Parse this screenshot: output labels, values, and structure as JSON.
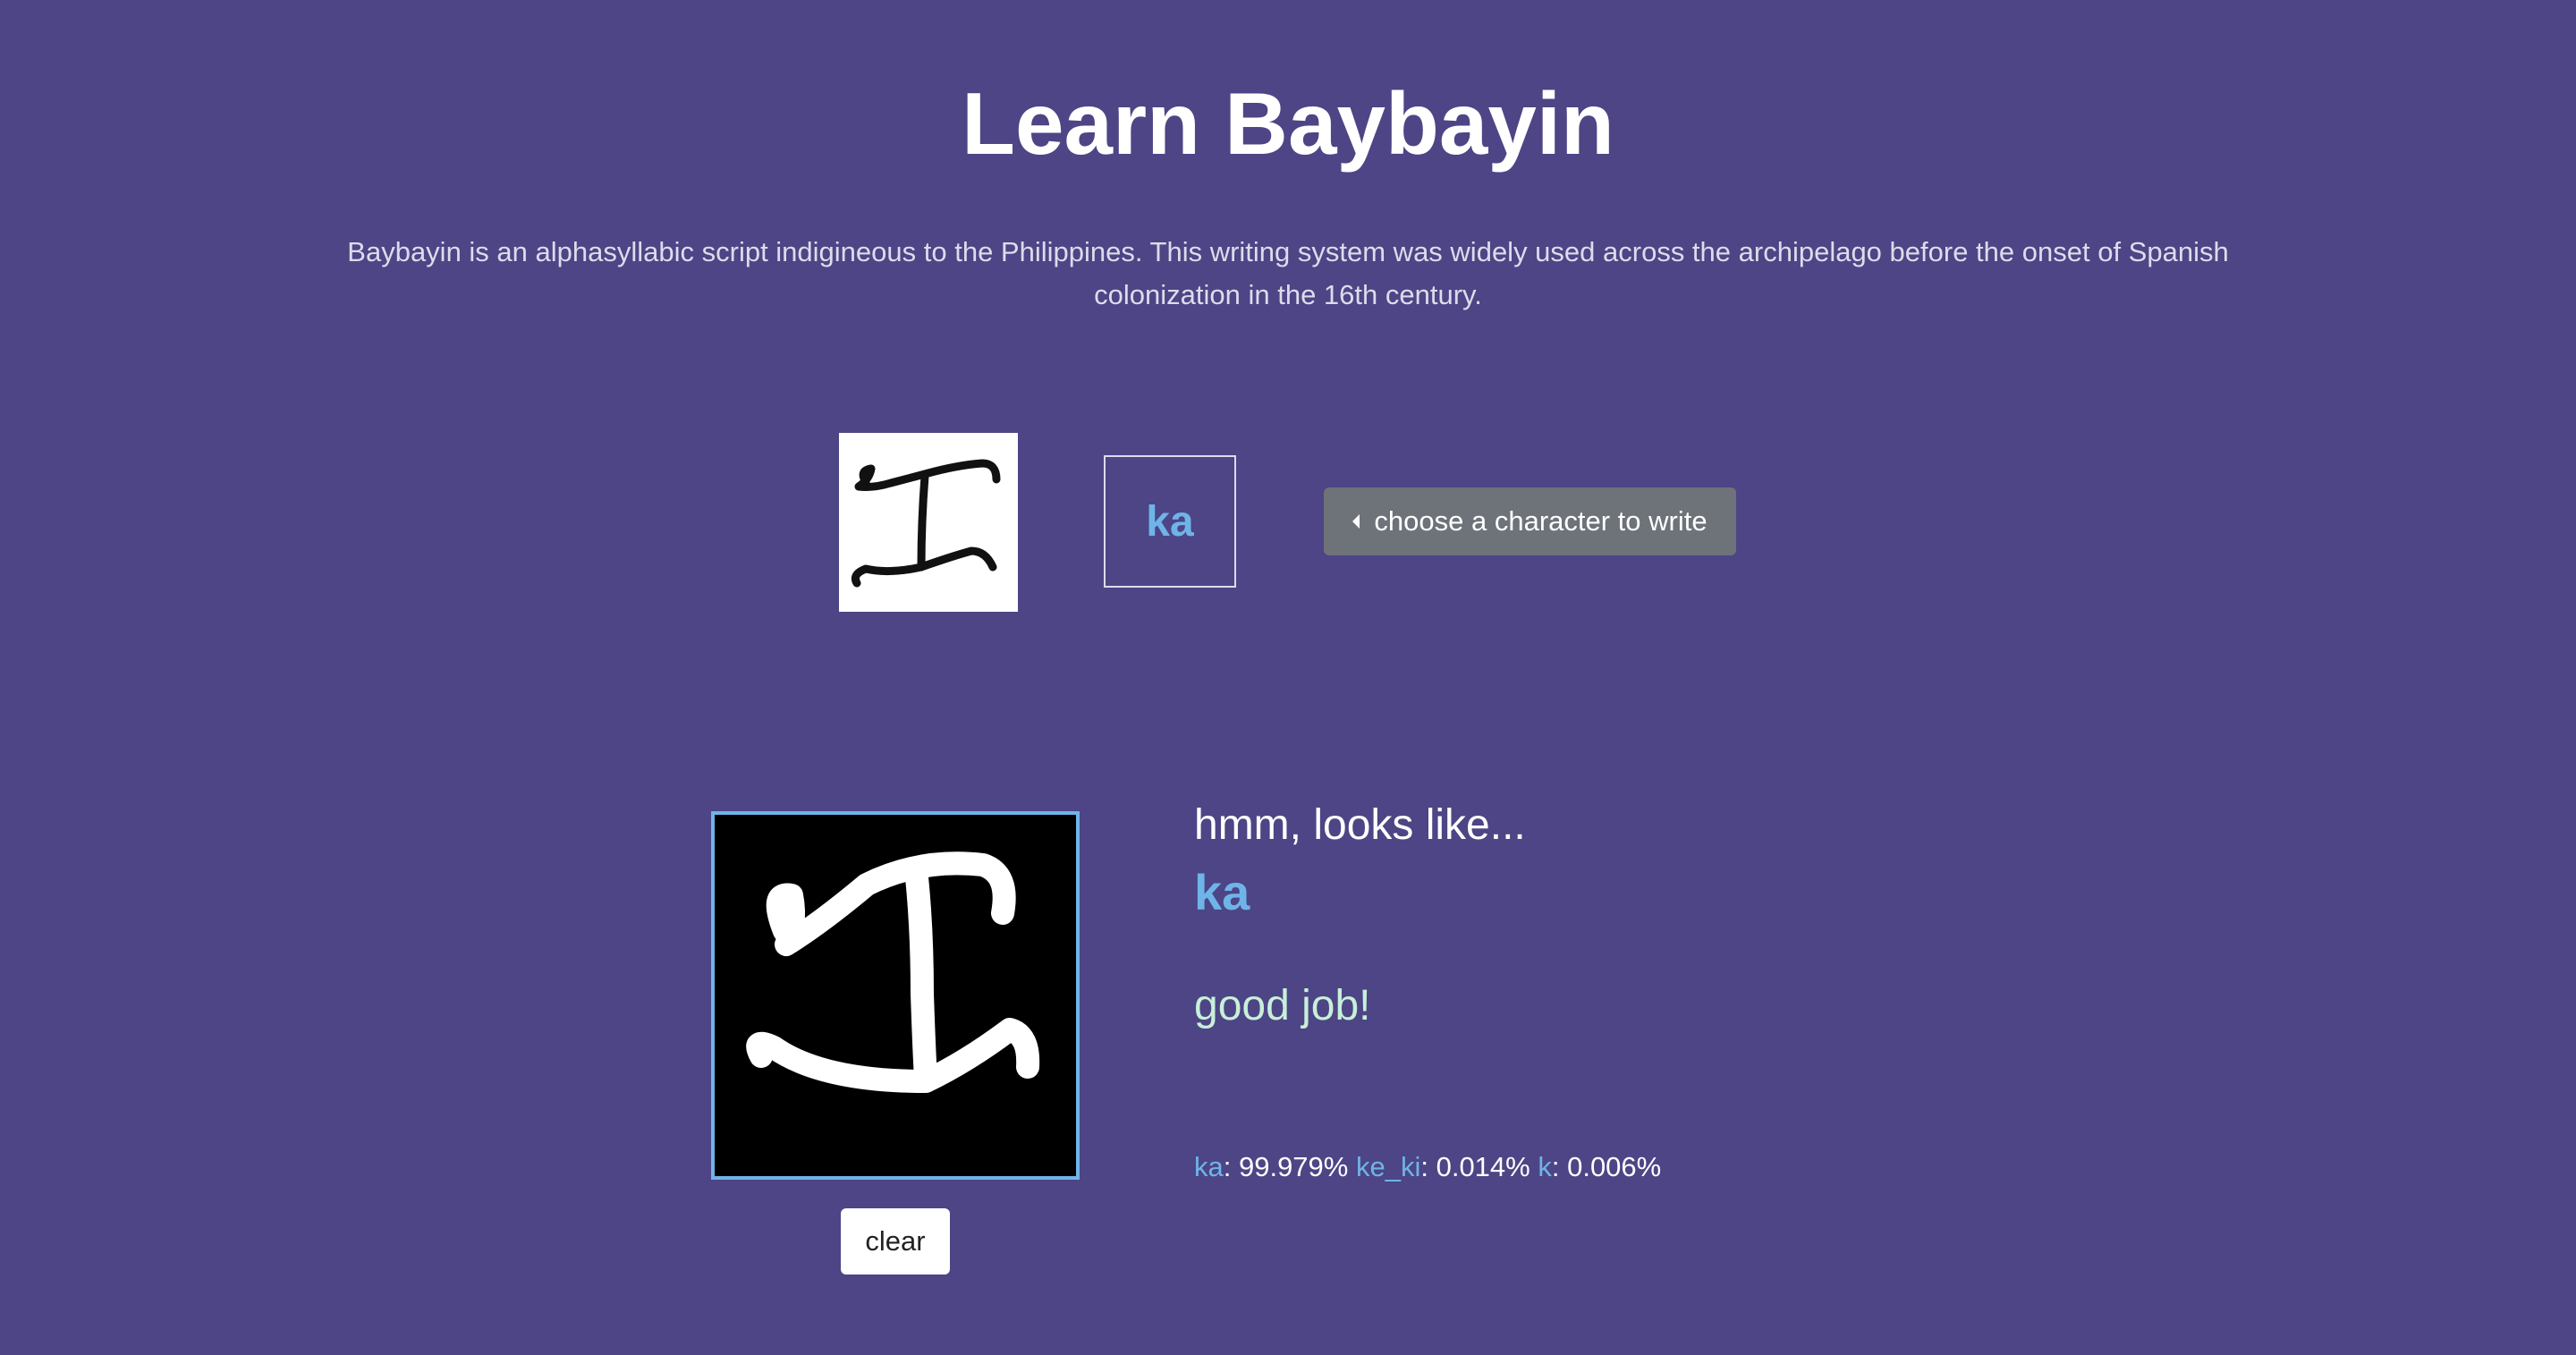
{
  "page": {
    "title": "Learn Baybayin",
    "description": "Baybayin is an alphasyllabic script indigineous to the Philippines. This writing system was widely used across the archipelago before the onset of Spanish colonization in the 16th century."
  },
  "selector": {
    "reference_image_icon": "baybayin-ka-glyph",
    "current_character": "ka",
    "choose_button_label": "choose a character to write",
    "choose_button_icon": "caret-left-icon"
  },
  "drawing": {
    "canvas_icon": "baybayin-ka-drawing",
    "clear_label": "clear"
  },
  "result": {
    "intro": "hmm, looks like...",
    "prediction": "ka",
    "feedback": "good job!",
    "scores": [
      {
        "label": "ka",
        "value": ": 99.979%"
      },
      {
        "label": "ke_ki",
        "value": ": 0.014%"
      },
      {
        "label": "k",
        "value": ": 0.006%"
      }
    ]
  },
  "colors": {
    "background": "#4d4585",
    "accent": "#6fb4e8",
    "success": "#c8f0d8",
    "button_gray": "#6e7279"
  }
}
